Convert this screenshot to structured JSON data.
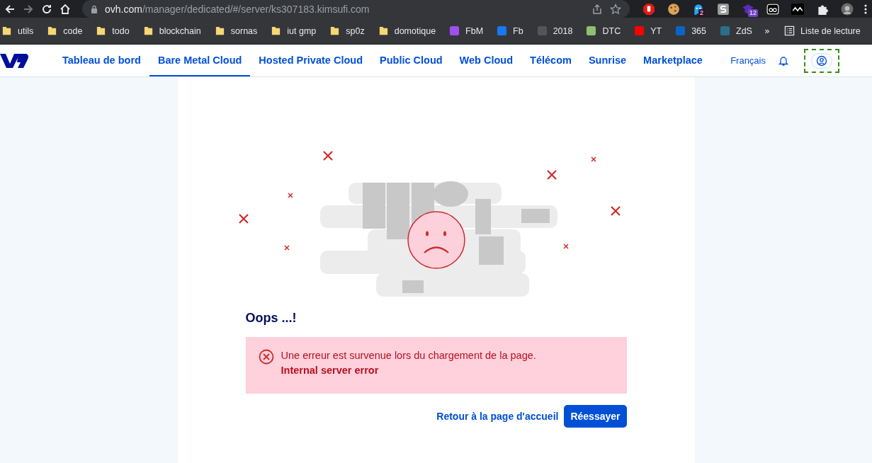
{
  "browser": {
    "address_host": "ovh.com",
    "address_path": "/manager/dedicated/#/server/ks307183.kimsufi.com",
    "extensions": [
      {
        "kind": "stop"
      },
      {
        "kind": "cookie"
      },
      {
        "kind": "ghost",
        "badge": "2"
      },
      {
        "kind": "s"
      },
      {
        "kind": "cap",
        "badge": "12"
      },
      {
        "kind": "eyes"
      },
      {
        "kind": "waves"
      },
      {
        "kind": "puzzle"
      },
      {
        "kind": "avatar"
      }
    ],
    "bookmarks": [
      {
        "kind": "folder",
        "label": "utils"
      },
      {
        "kind": "folder",
        "label": "code"
      },
      {
        "kind": "folder",
        "label": "todo"
      },
      {
        "kind": "folder",
        "label": "blockchain"
      },
      {
        "kind": "folder",
        "label": "sornas"
      },
      {
        "kind": "folder",
        "label": "iut gmp"
      },
      {
        "kind": "folder",
        "label": "sp0z"
      },
      {
        "kind": "folder",
        "label": "domotique"
      },
      {
        "kind": "site",
        "label": "FbM",
        "color": "#a050f0"
      },
      {
        "kind": "site",
        "label": "Fb",
        "color": "#1877f2"
      },
      {
        "kind": "site",
        "label": "2018",
        "color": "#555555"
      },
      {
        "kind": "site",
        "label": "DTC",
        "color": "#8fbf6f"
      },
      {
        "kind": "site",
        "label": "YT",
        "color": "#ff0000"
      },
      {
        "kind": "site",
        "label": "365",
        "color": "#0a64c8"
      },
      {
        "kind": "site",
        "label": "ZdS",
        "color": "#2a6f8a"
      }
    ],
    "more": "»",
    "reading_list": "Liste de lecture"
  },
  "nav": {
    "tabs": [
      {
        "label": "Tableau de bord",
        "selected": false
      },
      {
        "label": "Bare Metal Cloud",
        "selected": true
      },
      {
        "label": "Hosted Private Cloud",
        "selected": false
      },
      {
        "label": "Public Cloud",
        "selected": false
      },
      {
        "label": "Web Cloud",
        "selected": false
      },
      {
        "label": "Télécom",
        "selected": false
      },
      {
        "label": "Sunrise",
        "selected": false
      },
      {
        "label": "Marketplace",
        "selected": false
      }
    ],
    "language": "Français"
  },
  "error": {
    "title": "Oops ...!",
    "message": "Une erreur est survenue lors du chargement de la page.",
    "detail": "Internal server error",
    "link": "Retour à la page d'accueil",
    "button": "Réessayer"
  }
}
